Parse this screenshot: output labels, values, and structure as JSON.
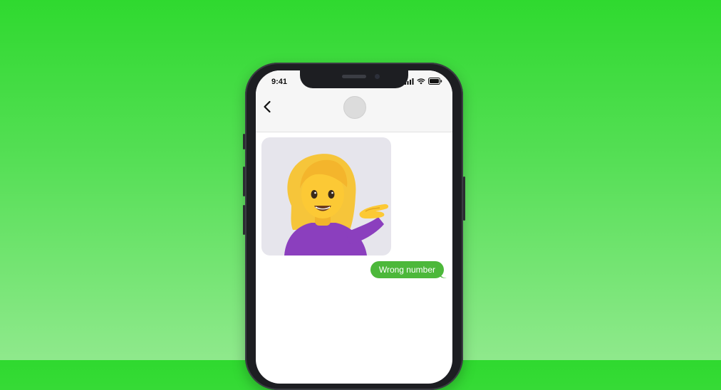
{
  "status_bar": {
    "time": "9:41",
    "signal_icon": "cellular-signal-icon",
    "wifi_icon": "wifi-icon",
    "battery_icon": "battery-icon"
  },
  "header": {
    "back_icon": "chevron-left-icon",
    "avatar_icon": "contact-avatar"
  },
  "messages": [
    {
      "type": "image",
      "direction": "incoming",
      "content": "woman-tipping-hand-emoji"
    },
    {
      "type": "text",
      "direction": "outgoing",
      "text": "Wrong number"
    }
  ],
  "colors": {
    "background_top": "#2fd92f",
    "background_bottom": "#8fe98c",
    "outgoing_bubble": "#4cb83a",
    "image_bubble_bg": "#e6e5ec"
  }
}
